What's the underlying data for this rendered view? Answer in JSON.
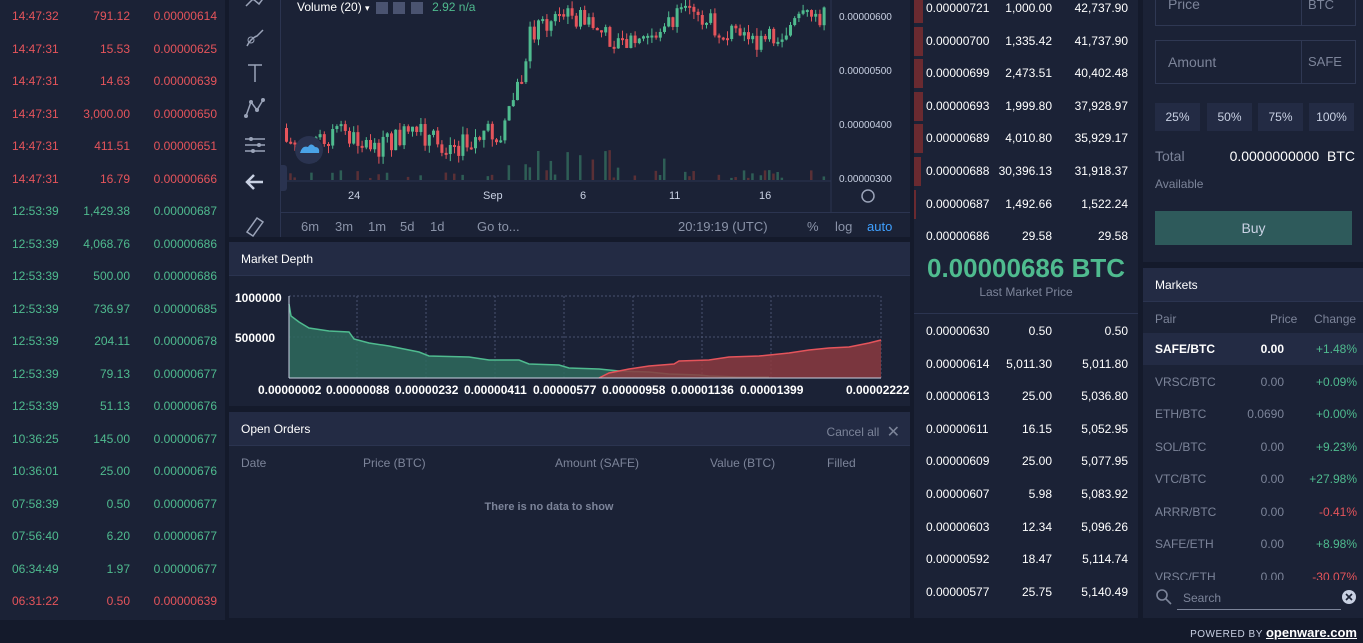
{
  "trades": [
    {
      "time": "14:47:32",
      "amount": "791.12",
      "price": "0.00000614",
      "side": "sell"
    },
    {
      "time": "14:47:31",
      "amount": "15.53",
      "price": "0.00000625",
      "side": "sell"
    },
    {
      "time": "14:47:31",
      "amount": "14.63",
      "price": "0.00000639",
      "side": "sell"
    },
    {
      "time": "14:47:31",
      "amount": "3,000.00",
      "price": "0.00000650",
      "side": "sell"
    },
    {
      "time": "14:47:31",
      "amount": "411.51",
      "price": "0.00000651",
      "side": "sell"
    },
    {
      "time": "14:47:31",
      "amount": "16.79",
      "price": "0.00000666",
      "side": "sell"
    },
    {
      "time": "12:53:39",
      "amount": "1,429.38",
      "price": "0.00000687",
      "side": "buy"
    },
    {
      "time": "12:53:39",
      "amount": "4,068.76",
      "price": "0.00000686",
      "side": "buy"
    },
    {
      "time": "12:53:39",
      "amount": "500.00",
      "price": "0.00000686",
      "side": "buy"
    },
    {
      "time": "12:53:39",
      "amount": "736.97",
      "price": "0.00000685",
      "side": "buy"
    },
    {
      "time": "12:53:39",
      "amount": "204.11",
      "price": "0.00000678",
      "side": "buy"
    },
    {
      "time": "12:53:39",
      "amount": "79.13",
      "price": "0.00000677",
      "side": "buy"
    },
    {
      "time": "12:53:39",
      "amount": "51.13",
      "price": "0.00000676",
      "side": "buy"
    },
    {
      "time": "10:36:25",
      "amount": "145.00",
      "price": "0.00000677",
      "side": "buy"
    },
    {
      "time": "10:36:01",
      "amount": "25.00",
      "price": "0.00000676",
      "side": "buy"
    },
    {
      "time": "07:58:39",
      "amount": "0.50",
      "price": "0.00000677",
      "side": "buy"
    },
    {
      "time": "07:56:40",
      "amount": "6.20",
      "price": "0.00000677",
      "side": "buy"
    },
    {
      "time": "06:34:49",
      "amount": "1.97",
      "price": "0.00000677",
      "side": "buy"
    },
    {
      "time": "06:31:22",
      "amount": "0.50",
      "price": "0.00000639",
      "side": "sell"
    }
  ],
  "chart": {
    "indicator": "Volume (20)",
    "indicator_values": "2.92 n/a",
    "price_labels": [
      "0.00000600",
      "0.00000500",
      "0.00000400",
      "0.00000300"
    ],
    "x_labels": [
      "24",
      "Sep",
      "6",
      "11",
      "16"
    ],
    "ranges": [
      "6m",
      "3m",
      "1m",
      "5d",
      "1d"
    ],
    "goto": "Go to...",
    "clock": "20:19:19 (UTC)",
    "pct": "%",
    "log": "log",
    "auto": "auto"
  },
  "depth": {
    "title": "Market Depth",
    "y_labels": [
      "1000000",
      "500000"
    ],
    "x_labels": [
      "0.00000002",
      "0.00000088",
      "0.00000232",
      "0.00000411",
      "0.00000577",
      "0.00000958",
      "0.00001136",
      "0.00001399",
      "0.00002222"
    ]
  },
  "orders": {
    "title": "Open Orders",
    "cancel_all": "Cancel all",
    "columns": [
      "Date",
      "Price (BTC)",
      "Amount (SAFE)",
      "Value (BTC)",
      "Filled"
    ],
    "empty": "There is no data to show"
  },
  "orderbook": {
    "asks": [
      {
        "price": "0.00000721",
        "amount": "1,000.00",
        "total": "42,737.90",
        "depth": 0.04
      },
      {
        "price": "0.00000700",
        "amount": "1,335.42",
        "total": "41,737.90",
        "depth": 0.04
      },
      {
        "price": "0.00000699",
        "amount": "2,473.51",
        "total": "40,402.48",
        "depth": 0.04
      },
      {
        "price": "0.00000693",
        "amount": "1,999.80",
        "total": "37,928.97",
        "depth": 0.04
      },
      {
        "price": "0.00000689",
        "amount": "4,010.80",
        "total": "35,929.17",
        "depth": 0.04
      },
      {
        "price": "0.00000688",
        "amount": "30,396.13",
        "total": "31,918.37",
        "depth": 0.03
      },
      {
        "price": "0.00000687",
        "amount": "1,492.66",
        "total": "1,522.24",
        "depth": 0.01
      },
      {
        "price": "0.00000686",
        "amount": "29.58",
        "total": "29.58",
        "depth": 0.0
      }
    ],
    "last_price": "0.00000686 BTC",
    "last_label": "Last Market Price",
    "bids": [
      {
        "price": "0.00000630",
        "amount": "0.50",
        "total": "0.50"
      },
      {
        "price": "0.00000614",
        "amount": "5,011.30",
        "total": "5,011.80"
      },
      {
        "price": "0.00000613",
        "amount": "25.00",
        "total": "5,036.80"
      },
      {
        "price": "0.00000611",
        "amount": "16.15",
        "total": "5,052.95"
      },
      {
        "price": "0.00000609",
        "amount": "25.00",
        "total": "5,077.95"
      },
      {
        "price": "0.00000607",
        "amount": "5.98",
        "total": "5,083.92"
      },
      {
        "price": "0.00000603",
        "amount": "12.34",
        "total": "5,096.26"
      },
      {
        "price": "0.00000592",
        "amount": "18.47",
        "total": "5,114.74"
      },
      {
        "price": "0.00000577",
        "amount": "25.75",
        "total": "5,140.49"
      }
    ]
  },
  "form": {
    "price_placeholder": "Price",
    "price_unit": "BTC",
    "amount_placeholder": "Amount",
    "amount_unit": "SAFE",
    "percents": [
      "25%",
      "50%",
      "75%",
      "100%"
    ],
    "total_label": "Total",
    "total_value": "0.0000000000",
    "total_unit": "BTC",
    "available": "Available",
    "buy": "Buy"
  },
  "markets": {
    "title": "Markets",
    "headers": {
      "pair": "Pair",
      "price": "Price",
      "change": "Change"
    },
    "rows": [
      {
        "pair": "SAFE/BTC",
        "price": "0.00",
        "change": "+1.48%",
        "dir": "up",
        "active": true
      },
      {
        "pair": "VRSC/BTC",
        "price": "0.00",
        "change": "+0.09%",
        "dir": "up"
      },
      {
        "pair": "ETH/BTC",
        "price": "0.0690",
        "change": "+0.00%",
        "dir": "up"
      },
      {
        "pair": "SOL/BTC",
        "price": "0.00",
        "change": "+9.23%",
        "dir": "up"
      },
      {
        "pair": "VTC/BTC",
        "price": "0.00",
        "change": "+27.98%",
        "dir": "up"
      },
      {
        "pair": "ARRR/BTC",
        "price": "0.00",
        "change": "-0.41%",
        "dir": "down"
      },
      {
        "pair": "SAFE/ETH",
        "price": "0.00",
        "change": "+8.98%",
        "dir": "up"
      },
      {
        "pair": "VRSC/ETH",
        "price": "0.00",
        "change": "-30.07%",
        "dir": "down"
      }
    ],
    "search_placeholder": "Search"
  },
  "footer": {
    "powered": "POWERED BY",
    "brand": "openware.com"
  },
  "colors": {
    "buy": "#4fbb8f",
    "sell": "#e5545b",
    "accent": "#3fa0ff",
    "panel": "#1b2236",
    "background": "#141a2b"
  }
}
